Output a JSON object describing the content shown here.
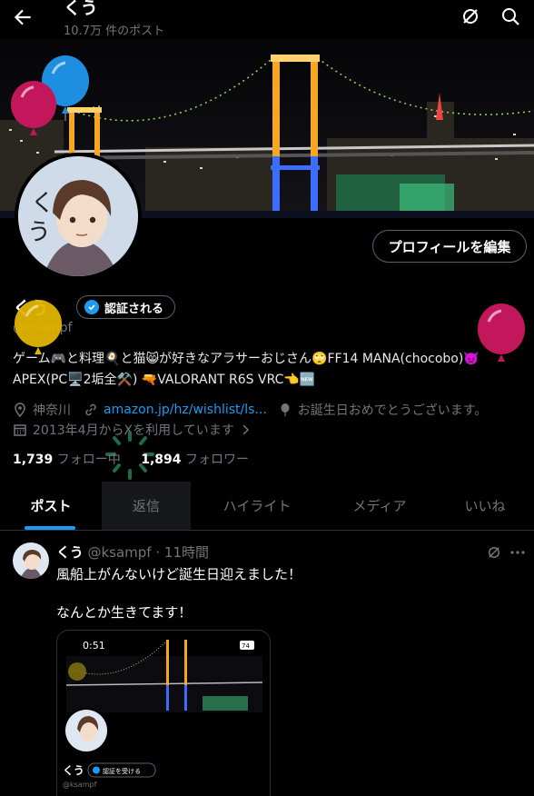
{
  "header": {
    "title": "くう",
    "subtitle": "10.7万 件のポスト"
  },
  "profile": {
    "name": "くう",
    "handle": "@ksampf",
    "verify_label": "認証される",
    "edit_label": "プロフィールを編集",
    "bio_line1": "ゲーム🎮と料理🍳と猫😸が好きなアラサーおじさん🙄FF14 MANA(chocobo)👿",
    "bio_line2": "APEX(PC🖥️2垢全⚒️) 🔫VALORANT R6S VRC👈🆕",
    "location": "神奈川",
    "link": "amazon.jp/hz/wishlist/ls...",
    "birthday": "お誕生日おめでとうございます。",
    "joined": "2013年4月からXを利用しています",
    "following_count": "1,739",
    "following_label": "フォロー中",
    "followers_count": "1,894",
    "followers_label": "フォロワー"
  },
  "tabs": [
    "ポスト",
    "返信",
    "ハイライト",
    "メディア",
    "いいね"
  ],
  "post": {
    "name": "くう",
    "handle": "@ksampf",
    "time": "· 11時間",
    "line1": "風船上がんないけど誕生日迎えました！",
    "line2": "なんとか生きてます！",
    "media": {
      "clock": "0:51",
      "battery": "74",
      "name": "くう",
      "verify_label": "認証を受ける",
      "handle": "@ksampf"
    }
  },
  "colors": {
    "accent": "#1d9bf0",
    "muted": "#71767b",
    "balloon_blue": "#1d8ee0",
    "balloon_pink": "#c2185b",
    "balloon_yellow": "#e0b400"
  },
  "icons": [
    "back-arrow-icon",
    "grok-icon",
    "search-icon",
    "location-icon",
    "link-icon",
    "balloon-icon",
    "calendar-icon",
    "more-icon"
  ]
}
